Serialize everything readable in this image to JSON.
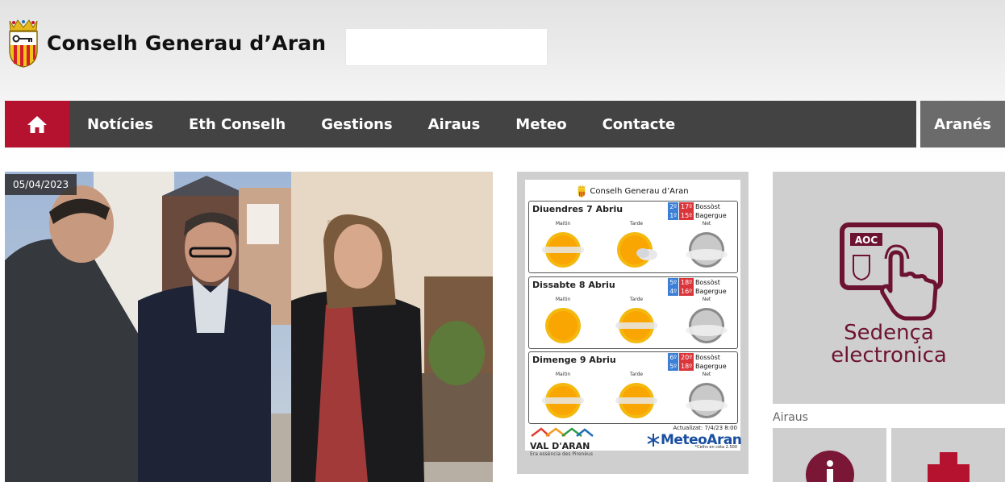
{
  "header": {
    "title": "Conselh Generau d’Aran",
    "search": {
      "value": "",
      "placeholder": ""
    }
  },
  "nav": {
    "home_icon": "home-icon",
    "items": [
      "Notícies",
      "Eth Conselh",
      "Gestions",
      "Airaus",
      "Meteo",
      "Contacte"
    ],
    "language": "Aranés"
  },
  "news": {
    "date": "05/04/2023"
  },
  "meteo": {
    "header": "Conselh Generau d’Aran",
    "periods": [
      "Maitin",
      "Tarde",
      "Net"
    ],
    "days": [
      {
        "name": "Diuendres 7 Abriu",
        "temps": [
          {
            "min": "2º",
            "max": "17º",
            "loc": "Bossòst"
          },
          {
            "min": "1º",
            "max": "15º",
            "loc": "Bagergue"
          }
        ],
        "icons": [
          "sun-haze-icon",
          "sun-cloud-icon",
          "moon-cloud-icon"
        ]
      },
      {
        "name": "Dissabte 8 Abriu",
        "temps": [
          {
            "min": "5º",
            "max": "18º",
            "loc": "Bossòst"
          },
          {
            "min": "4º",
            "max": "16º",
            "loc": "Bagergue"
          }
        ],
        "icons": [
          "sun-icon",
          "sun-haze-icon",
          "moon-cloud-icon"
        ]
      },
      {
        "name": "Dimenge 9 Abriu",
        "temps": [
          {
            "min": "6º",
            "max": "20º",
            "loc": "Bossòst"
          },
          {
            "min": "5º",
            "max": "18º",
            "loc": "Bagergue"
          }
        ],
        "icons": [
          "sun-haze-icon",
          "sun-haze-icon",
          "moon-cloud-icon"
        ]
      }
    ],
    "updated": "Actualizat: 7/4/23  8:00",
    "val_aran": "VAL D'ARAN",
    "val_aran_sub": "Era essència des Pirenèus",
    "brand": "MeteoAran",
    "note": "*Celhs en còta 2.500"
  },
  "sede": {
    "line1": "Sedença",
    "line2": "electronica",
    "aoc": "AOC"
  },
  "airaus": {
    "label": "Airaus"
  },
  "colors": {
    "brand": "#b5122f",
    "nav": "#434343",
    "lang": "#6b6b6b",
    "sede": "#6d1332"
  }
}
